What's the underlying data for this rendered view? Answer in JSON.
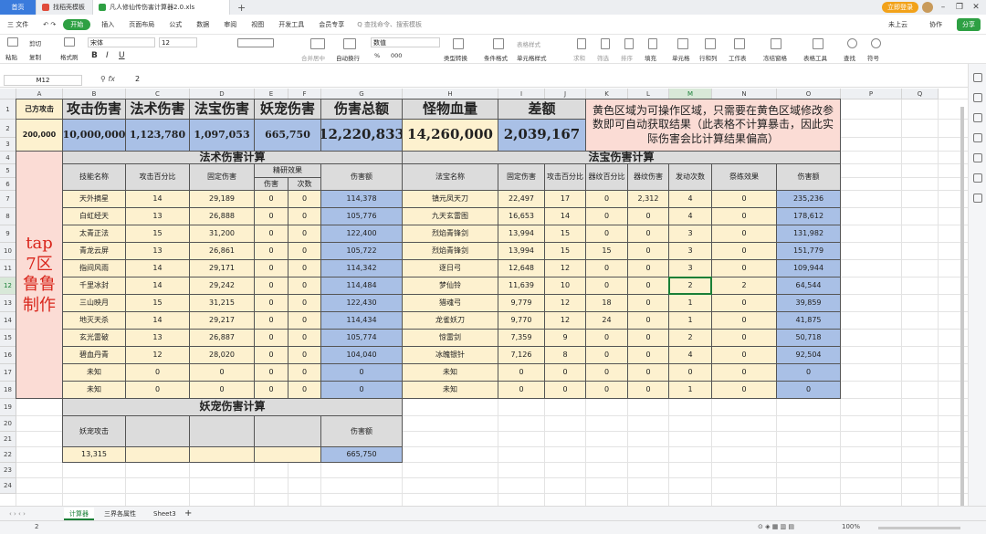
{
  "titlebar": {
    "home": "首页",
    "tab1": "找稻壳模板",
    "tab2": "凡人修仙传伤害计算器2.0.xls",
    "add": "+",
    "vip": "立即登录"
  },
  "menu": {
    "file": "三 文件",
    "start": "开始",
    "items": [
      "插入",
      "页面布局",
      "公式",
      "数据",
      "审阅",
      "视图",
      "开发工具",
      "会员专享"
    ],
    "search": "Q 查找命令、搜索模板",
    "cloud": "未上云",
    "collab": "协作",
    "share": "分享"
  },
  "toolbar": {
    "paste": "粘贴",
    "cut": "剪切",
    "copy": "复制",
    "painter": "格式刷",
    "font": "宋体",
    "size": "12",
    "merge": "合并居中",
    "wrap": "自动换行",
    "format": "数值",
    "condition": "条件格式",
    "celltype": "类型转换",
    "tablestyle": "表格样式",
    "cellstyle": "单元格样式",
    "sum": "求和",
    "filter": "筛选",
    "sort": "排序",
    "fill": "填充",
    "cell": "单元格",
    "rowcol": "行和列",
    "sheet": "工作表",
    "freeze": "冻结窗格",
    "tabletools": "表格工具",
    "find": "查找",
    "symbol": "符号",
    "bold": "B",
    "italic": "I",
    "underline": "U",
    "percent": "%",
    "thousands": "000"
  },
  "formula": {
    "namebox": "M12",
    "fx": "fx",
    "value": "2"
  },
  "columns": [
    "A",
    "B",
    "C",
    "D",
    "E",
    "F",
    "G",
    "H",
    "I",
    "J",
    "K",
    "L",
    "M",
    "N",
    "O",
    "P",
    "Q"
  ],
  "rows": [
    "1",
    "2",
    "3",
    "4",
    "5",
    "6",
    "7",
    "8",
    "9",
    "10",
    "11",
    "12",
    "13",
    "14",
    "15",
    "16",
    "17",
    "18",
    "19",
    "20",
    "21",
    "22",
    "23",
    "24"
  ],
  "sheet": {
    "r1": {
      "own": "己方攻击",
      "atk": "攻击伤害",
      "magic": "法术伤害",
      "treasure": "法宝伤害",
      "pet": "妖宠伤害",
      "total": "伤害总额",
      "monster": "怪物血量",
      "diff": "差额",
      "note": "黄色区域为可操作区域，只需要在黄色区域修改参数即可自动获取结果（此表格不计算暴击，因此实际伤害会比计算结果偏高）"
    },
    "r2": {
      "own": "200,000",
      "atk": "10,000,000",
      "magic": "1,123,780",
      "treasure": "1,097,053",
      "pet": "665,750",
      "total": "12,220,833",
      "monster": "14,260,000",
      "diff": "2,039,167"
    },
    "side": "tap\n7区\n鲁鲁\n制作",
    "magic_title": "法术伤害计算",
    "treasure_title": "法宝伤害计算",
    "magic_headers": {
      "name": "技能名称",
      "pct": "攻击百分比",
      "fixed": "固定伤害",
      "refine": "精研效果",
      "dmg": "伤害",
      "times": "次数",
      "amount": "伤害额"
    },
    "treasure_headers": {
      "name": "法宝名称",
      "fixed": "固定伤害",
      "pct": "攻击百分比",
      "lvpct": "器纹百分比",
      "lvdmg": "器纹伤害",
      "count": "发动次数",
      "sacrifice": "祭练效果",
      "amount": "伤害额"
    },
    "magic_rows": [
      [
        "天外摘星",
        "14",
        "29,189",
        "0",
        "0",
        "114,378"
      ],
      [
        "白虹经天",
        "13",
        "26,888",
        "0",
        "0",
        "105,776"
      ],
      [
        "太青正法",
        "15",
        "31,200",
        "0",
        "0",
        "122,400"
      ],
      [
        "青龙云屏",
        "13",
        "26,861",
        "0",
        "0",
        "105,722"
      ],
      [
        "指间风雨",
        "14",
        "29,171",
        "0",
        "0",
        "114,342"
      ],
      [
        "千里冰封",
        "14",
        "29,242",
        "0",
        "0",
        "114,484"
      ],
      [
        "三山映月",
        "15",
        "31,215",
        "0",
        "0",
        "122,430"
      ],
      [
        "地灭天杀",
        "14",
        "29,217",
        "0",
        "0",
        "114,434"
      ],
      [
        "玄光雷破",
        "13",
        "26,887",
        "0",
        "0",
        "105,774"
      ],
      [
        "碧血丹青",
        "12",
        "28,020",
        "0",
        "0",
        "104,040"
      ],
      [
        "未知",
        "0",
        "0",
        "0",
        "0",
        "0"
      ],
      [
        "未知",
        "0",
        "0",
        "0",
        "0",
        "0"
      ]
    ],
    "treasure_rows": [
      [
        "镇元凤天刀",
        "22,497",
        "17",
        "0",
        "2,312",
        "4",
        "0",
        "235,236"
      ],
      [
        "九天玄雷图",
        "16,653",
        "14",
        "0",
        "0",
        "4",
        "0",
        "178,612"
      ],
      [
        "烈焰青锋剑",
        "13,994",
        "15",
        "0",
        "0",
        "3",
        "0",
        "131,982"
      ],
      [
        "烈焰青锋剑",
        "13,994",
        "15",
        "15",
        "0",
        "3",
        "0",
        "151,779"
      ],
      [
        "逐日弓",
        "12,648",
        "12",
        "0",
        "0",
        "3",
        "0",
        "109,944"
      ],
      [
        "梦仙铃",
        "11,639",
        "10",
        "0",
        "0",
        "2",
        "2",
        "64,544"
      ],
      [
        "猎魂弓",
        "9,779",
        "12",
        "18",
        "0",
        "1",
        "0",
        "39,859"
      ],
      [
        "龙雀妖刀",
        "9,770",
        "12",
        "24",
        "0",
        "1",
        "0",
        "41,875"
      ],
      [
        "惊雷剑",
        "7,359",
        "9",
        "0",
        "0",
        "2",
        "0",
        "50,718"
      ],
      [
        "冰魄银针",
        "7,126",
        "8",
        "0",
        "0",
        "4",
        "0",
        "92,504"
      ],
      [
        "未知",
        "0",
        "0",
        "0",
        "0",
        "0",
        "0",
        "0"
      ],
      [
        "未知",
        "0",
        "0",
        "0",
        "0",
        "1",
        "0",
        "0"
      ]
    ],
    "pet_title": "妖宠伤害计算",
    "pet_headers": {
      "atk": "妖宠攻击",
      "amount": "伤害额"
    },
    "pet_row": {
      "atk": "13,315",
      "amount": "665,750"
    }
  },
  "sheets": [
    "计算器",
    "三界各属性",
    "Sheet3"
  ],
  "status": {
    "value": "2",
    "zoom": "100%"
  },
  "colors": {
    "yellow": "#fdf1cf",
    "blue": "#a9c0e6",
    "pink": "#fbdcd5",
    "gray": "#dcdcdc",
    "red": "#d9261c",
    "green": "#1a7f37"
  }
}
